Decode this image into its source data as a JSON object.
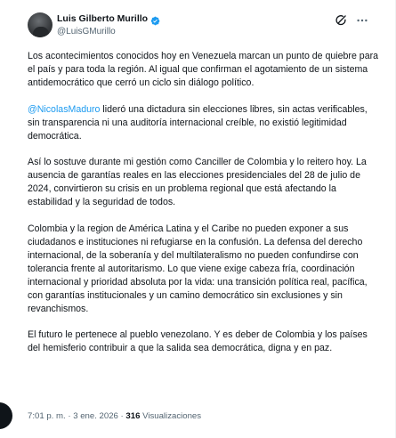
{
  "author": {
    "name": "Luis Gilberto Murillo",
    "handle": "@LuisGMurillo",
    "verified": true,
    "verified_color": "#1d9bf0"
  },
  "header_actions": {
    "grok_icon": "grok-icon",
    "more_icon": "more-icon"
  },
  "tweet": {
    "p1": "Los acontecimientos conocidos hoy en Venezuela marcan un punto de quiebre para el país y para toda la región. Al igual que confirman el agotamiento de un sistema antidemocrático que cerró un ciclo sin diálogo político.",
    "p2_mention": "@NicolasMaduro",
    "p2_text": " lideró una dictadura sin elecciones libres, sin actas verificables, sin transparencia ni una auditoría internacional creíble, no existió legitimidad democrática.",
    "p3": "Así lo sostuve durante mi gestión como Canciller de Colombia y lo reitero hoy. La ausencia de garantías reales en las elecciones presidenciales del 28 de julio de 2024, convirtieron su crisis en un problema regional que está afectando la estabilidad y la seguridad de todos.",
    "p4": "Colombia y la region de América Latina y el Caribe no pueden exponer a sus ciudadanos e instituciones ni refugiarse en la confusión. La defensa del derecho internacional, de la soberanía y del multilateralismo no pueden confundirse con tolerancia frente al autoritarismo. Lo que viene exige cabeza fría, coordinación internacional y prioridad absoluta por la vida: una transición política real, pacífica, con garantías institucionales y un camino democrático sin exclusiones y sin revanchismos.",
    "p5": "El futuro le pertenece al pueblo venezolano. Y es deber de Colombia y los países del hemisferio contribuir a que la salida sea democrática, digna y en paz."
  },
  "meta": {
    "time": "7:01 p. m.",
    "separator": " · ",
    "date": "3 ene. 2026",
    "views_count": "316",
    "views_label": " Visualizaciones"
  },
  "colors": {
    "text": "#0f1419",
    "secondary": "#536471",
    "link": "#1d9bf0"
  }
}
